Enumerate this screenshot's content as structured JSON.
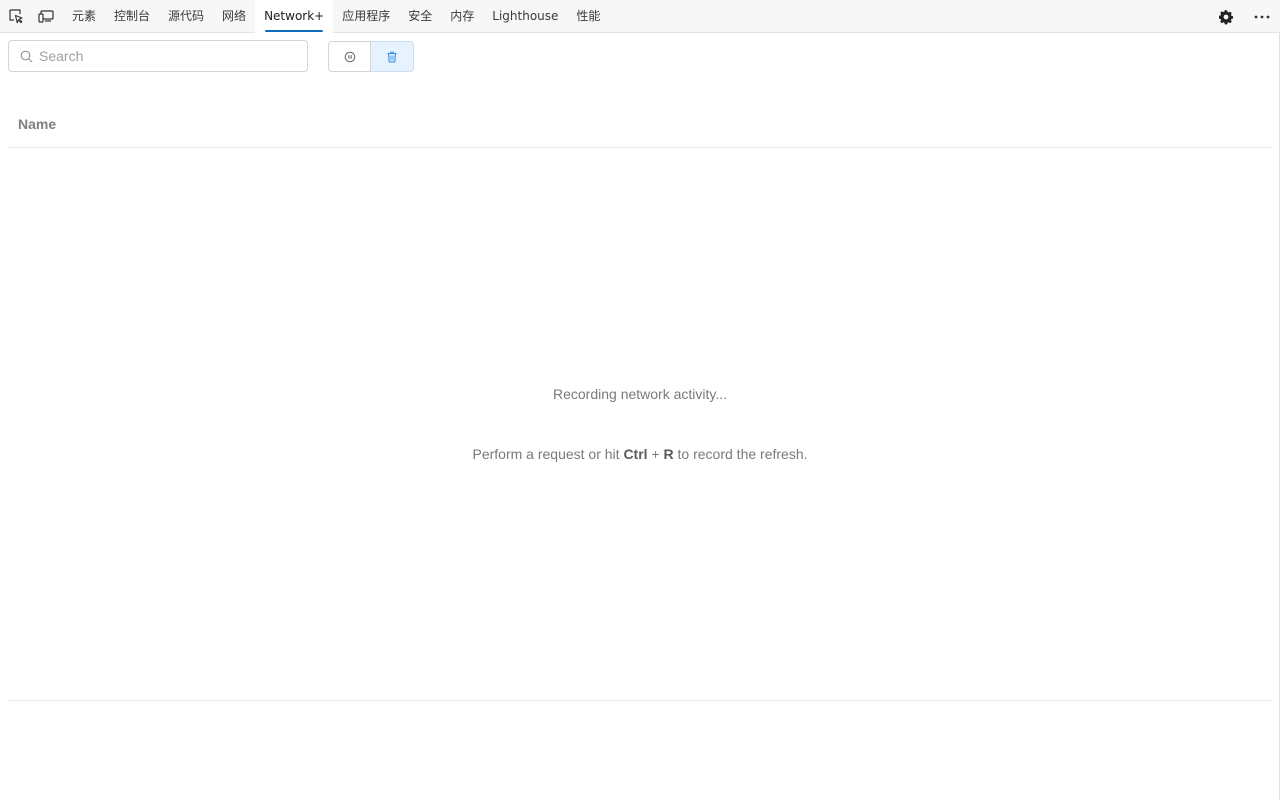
{
  "tabs": [
    {
      "label": "元素"
    },
    {
      "label": "控制台"
    },
    {
      "label": "源代码"
    },
    {
      "label": "网络"
    },
    {
      "label": "Network+",
      "active": true
    },
    {
      "label": "应用程序"
    },
    {
      "label": "安全"
    },
    {
      "label": "内存"
    },
    {
      "label": "Lighthouse"
    },
    {
      "label": "性能"
    }
  ],
  "icons": {
    "inspect": "inspect-element-icon",
    "device": "device-emulation-icon",
    "settings": "gear-icon",
    "more": "more-options-icon",
    "search": "search-icon",
    "record": "record-icon",
    "clear": "trash-icon"
  },
  "search": {
    "placeholder": "Search",
    "value": ""
  },
  "table": {
    "columns": [
      "Name"
    ]
  },
  "empty_state": {
    "title": "Recording network activity...",
    "hint_prefix": "Perform a request or hit",
    "key1": "Ctrl",
    "plus": "+",
    "key2": "R",
    "hint_suffix": "to record the refresh."
  },
  "colors": {
    "accent": "#0f6cbd",
    "clear_button_bg": "#e6f2fd"
  }
}
